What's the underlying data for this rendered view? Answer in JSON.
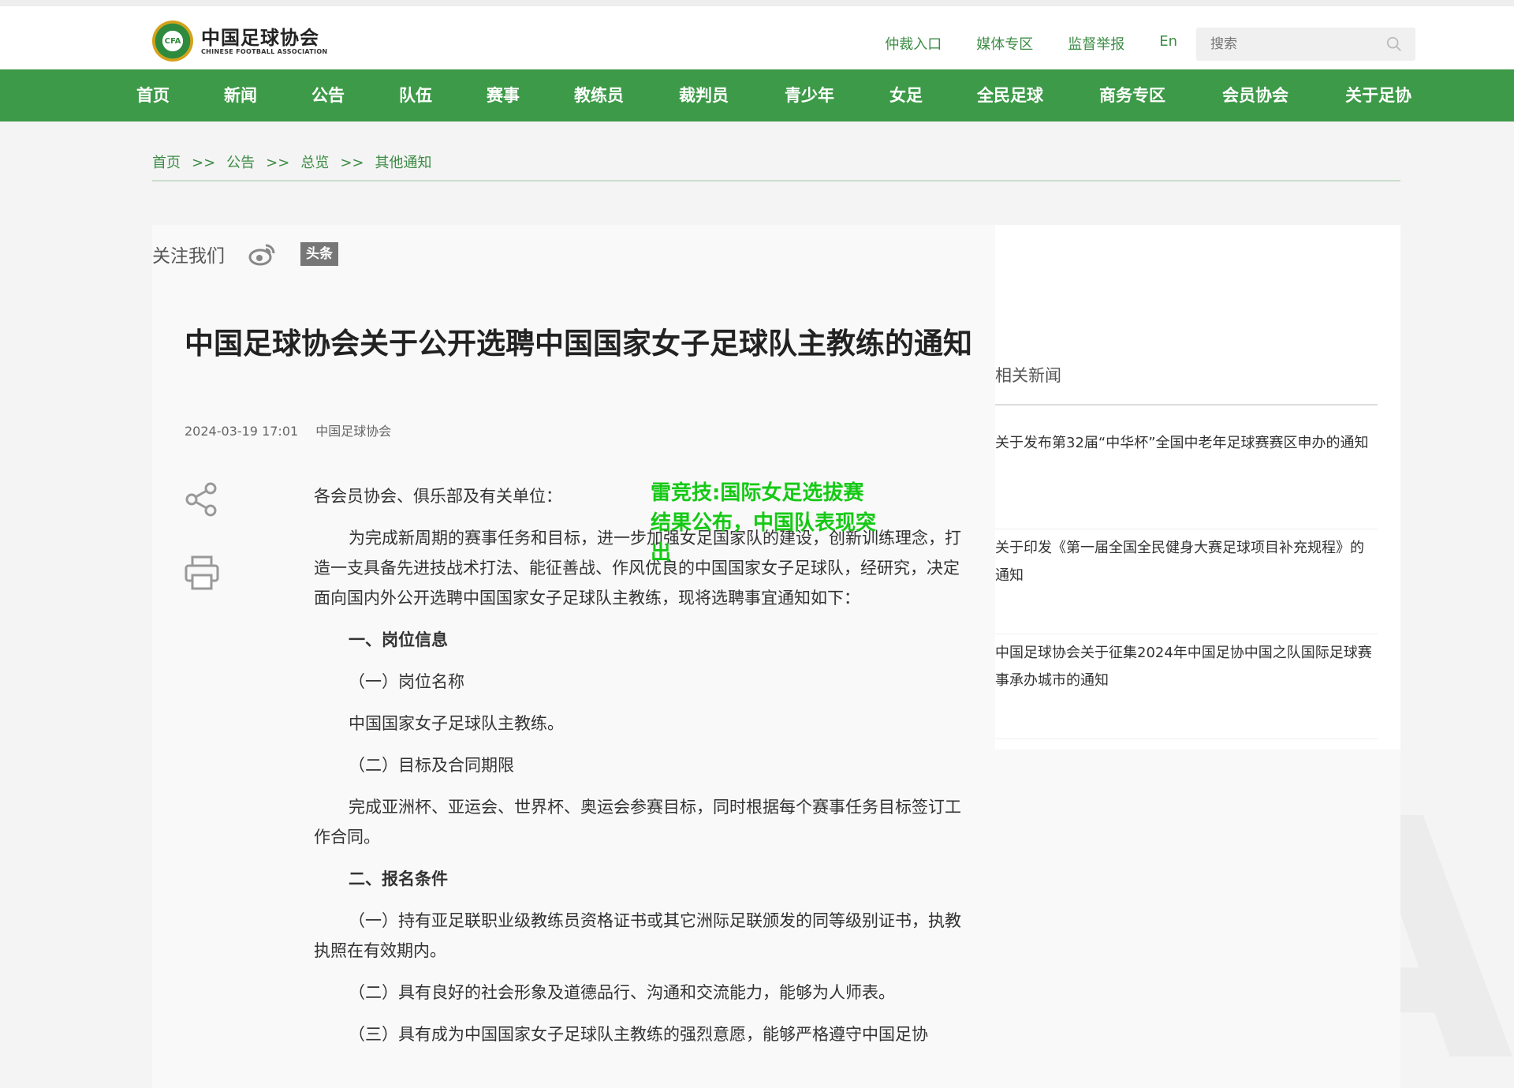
{
  "header": {
    "logo_cn": "中国足球协会",
    "logo_en": "CHINESE FOOTBALL ASSOCIATION",
    "logo_badge": "CFA",
    "links": [
      "仲裁入口",
      "媒体专区",
      "监督举报",
      "En"
    ],
    "search_placeholder": "搜索"
  },
  "nav": [
    "首页",
    "新闻",
    "公告",
    "队伍",
    "赛事",
    "教练员",
    "裁判员",
    "青少年",
    "女足",
    "全民足球",
    "商务专区",
    "会员协会",
    "关于足协"
  ],
  "breadcrumb": {
    "items": [
      "首页",
      "公告",
      "总览",
      "其他通知"
    ],
    "separator": ">>"
  },
  "follow": {
    "label": "关注我们",
    "toutiao": "头条"
  },
  "share_label": "分享",
  "article": {
    "title": "中国足球协会关于公开选聘中国国家女子足球队主教练的通知",
    "date": "2024-03-19 17:01",
    "source": "中国足球协会",
    "paragraphs": {
      "p1": "各会员协会、俱乐部及有关单位：",
      "p2": "为完成新周期的赛事任务和目标，进一步加强女足国家队的建设，创新训练理念，打造一支具备先进技战术打法、能征善战、作风优良的中国国家女子足球队，经研究，决定面向国内外公开选聘中国国家女子足球队主教练，现将选聘事宜通知如下：",
      "h1": "一、岗位信息",
      "s1": "（一）岗位名称",
      "p3": "中国国家女子足球队主教练。",
      "s2": "（二）目标及合同期限",
      "p4": "完成亚洲杯、亚运会、世界杯、奥运会参赛目标，同时根据每个赛事任务目标签订工作合同。",
      "h2": "二、报名条件",
      "p5": "（一）持有亚足联职业级教练员资格证书或其它洲际足联颁发的同等级别证书，执教执照在有效期内。",
      "p6": "（二）具有良好的社会形象及道德品行、沟通和交流能力，能够为人师表。",
      "p7": "（三）具有成为中国国家女子足球队主教练的强烈意愿，能够严格遵守中国足协"
    }
  },
  "overlay_text": "雷竞技:国际女足选拔赛结果公布，中国队表现突出",
  "related": {
    "title": "相关新闻",
    "items": [
      "关于发布第32届“中华杯”全国中老年足球赛赛区申办的通知",
      "关于印发《第一届全国全民健身大赛足球项目补充规程》的通知",
      "中国足球协会关于征集2024年中国足协中国之队国际足球赛事承办城市的通知"
    ]
  },
  "watermark": "CFA",
  "colors": {
    "brand_green": "#3d9a48",
    "link_green": "#3c8c45",
    "overlay_green": "#15c915"
  }
}
